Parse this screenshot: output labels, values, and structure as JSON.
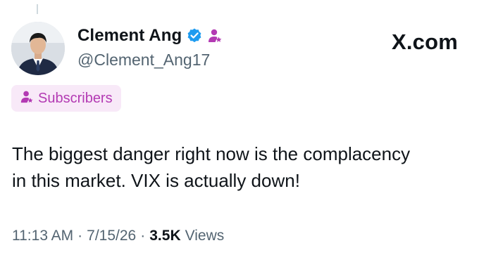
{
  "author": {
    "display_name": "Clement Ang",
    "handle": "@Clement_Ang17",
    "verified_icon": "verified-badge-icon",
    "subscriber_icon": "subscriber-person-star-icon"
  },
  "brand": {
    "label": "X.com"
  },
  "subscribers_badge": {
    "label": "Subscribers",
    "icon": "subscriber-person-star-icon"
  },
  "tweet": {
    "text": "The biggest danger right now is the complacency\nin this market. VIX is actually down!"
  },
  "meta": {
    "time": "11:13 AM",
    "separator": "·",
    "date": "7/15/26",
    "views_count": "3.5K",
    "views_label": "Views"
  },
  "colors": {
    "verified_blue": "#1d9bf0",
    "subscriber_purple": "#b33ab3",
    "badge_bg": "#f8e9f8",
    "secondary_text": "#536471"
  }
}
